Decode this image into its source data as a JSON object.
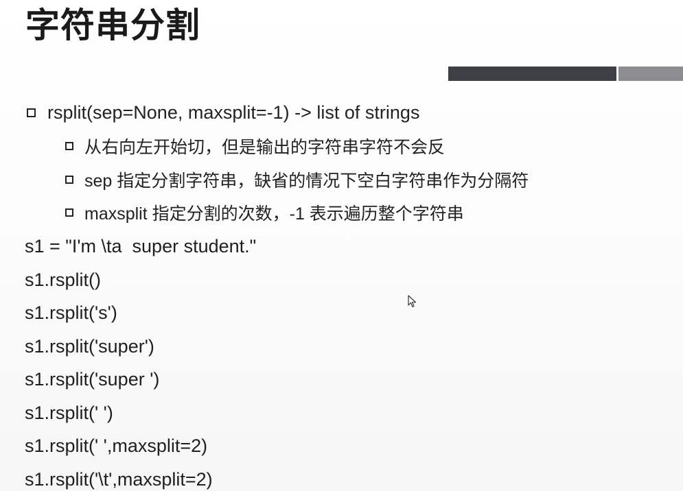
{
  "slide": {
    "title": "字符串分割",
    "bullets": [
      {
        "level": 1,
        "text": "rsplit(sep=None, maxsplit=-1) -> list of strings"
      },
      {
        "level": 2,
        "text": "从右向左开始切，但是输出的字符串字符不会反"
      },
      {
        "level": 2,
        "text": "sep 指定分割字符串，缺省的情况下空白字符串作为分隔符"
      },
      {
        "level": 2,
        "text": "maxsplit 指定分割的次数，-1 表示遍历整个字符串"
      }
    ],
    "code_lines": [
      "s1 = \"I'm \\ta  super student.\"",
      "s1.rsplit()",
      "s1.rsplit('s')",
      "s1.rsplit('super')",
      "s1.rsplit('super ')",
      "s1.rsplit(' ')",
      "s1.rsplit(' ',maxsplit=2)",
      "s1.rsplit('\\t',maxsplit=2)"
    ]
  },
  "colors": {
    "title_bar_dark": "#3f3f46",
    "title_bar_light": "#8d8d8f",
    "text": "#222222"
  },
  "icons": {
    "bullet": "square-bullet-icon",
    "pointer": "mouse-cursor-icon"
  }
}
